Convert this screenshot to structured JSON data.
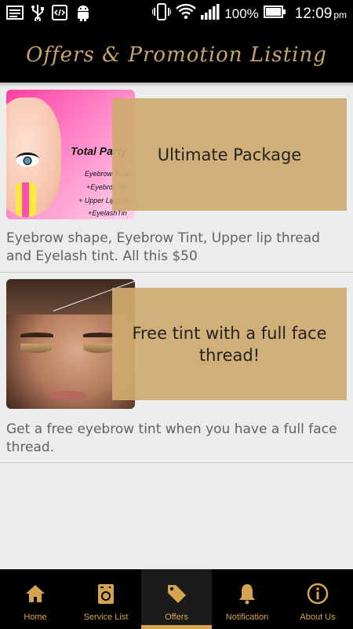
{
  "status_bar": {
    "battery": "100%",
    "time": "12:09",
    "ampm": "pm"
  },
  "header": {
    "title": "Offers & Promotion Listing"
  },
  "offers": [
    {
      "title": "Ultimate Package",
      "description": "Eyebrow shape, Eyebrow Tint, Upper lip thread and Eyelash tint.  All this $50",
      "image_text": {
        "heading": "Total Party",
        "lines": [
          "Eyebrow Shap",
          "+EyebrowTin",
          "+ Upper LipThre",
          "+EyelashTin"
        ]
      }
    },
    {
      "title": "Free tint with a full face thread!",
      "description": "Get a free eyebrow tint when you have a full face thread."
    }
  ],
  "bottom_nav": {
    "items": [
      {
        "label": "Home",
        "icon": "home-icon"
      },
      {
        "label": "Service List",
        "icon": "washing-machine-icon"
      },
      {
        "label": "Offers",
        "icon": "tag-icon",
        "active": true
      },
      {
        "label": "Notification",
        "icon": "bell-icon"
      },
      {
        "label": "About Us",
        "icon": "info-icon"
      }
    ]
  },
  "colors": {
    "accent": "#d4a44f",
    "header_title": "#c9a46b",
    "overlay": "#cfaa70",
    "background": "#ececec"
  }
}
